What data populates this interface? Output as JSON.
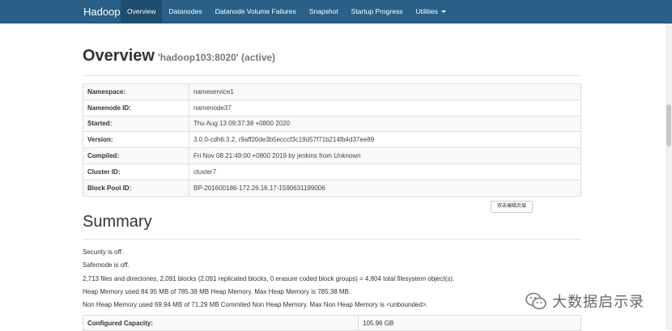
{
  "nav": {
    "brand": "Hadoop",
    "items": [
      "Overview",
      "Datanodes",
      "Datanode Volume Failures",
      "Snapshot",
      "Startup Progress",
      "Utilities"
    ]
  },
  "overview": {
    "title": "Overview",
    "subtitle": "'hadoop103:8020' (active)",
    "rows": [
      {
        "key": "Namespace:",
        "value": "nameservice1"
      },
      {
        "key": "Namenode ID:",
        "value": "namenode37"
      },
      {
        "key": "Started:",
        "value": "Thu Aug 13 09:37:38 +0800 2020"
      },
      {
        "key": "Version:",
        "value": "3.0.0-cdh6.3.2, r9aff20de3b5ecccf3c19d57f71b214fb4d37ee89"
      },
      {
        "key": "Compiled:",
        "value": "Fri Nov 08 21:49:00 +0800 2019 by jenkins from Unknown"
      },
      {
        "key": "Cluster ID:",
        "value": "cluster7"
      },
      {
        "key": "Block Pool ID:",
        "value": "BP-201600186-172.26.16.17-1590631199006"
      }
    ]
  },
  "edit_button": "双击编辑页眉",
  "summary": {
    "title": "Summary",
    "lines": [
      "Security is off.",
      "Safemode is off.",
      "2,713 files and directories, 2,091 blocks (2,091 replicated blocks, 0 erasure coded block groups) = 4,804 total filesystem object(s).",
      "Heap Memory used 84.95 MB of 785.38 MB Heap Memory. Max Heap Memory is 785.38 MB.",
      "Non Heap Memory used 69.94 MB of 71.29 MB Commited Non Heap Memory. Max Non Heap Memory is <unbounded>."
    ],
    "capacity": {
      "key": "Configured Capacity:",
      "value": "105.96 GB"
    }
  },
  "watermark": "大数据启示录"
}
